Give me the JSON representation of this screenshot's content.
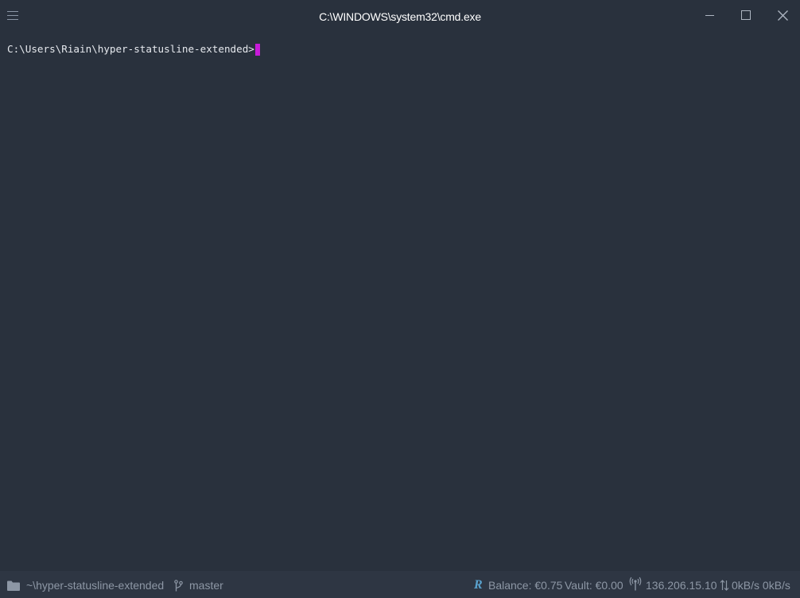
{
  "window": {
    "title": "C:\\WINDOWS\\system32\\cmd.exe",
    "menu_icon": "hamburger-menu-icon",
    "controls": [
      "minimize-icon",
      "maximize-icon",
      "close-icon"
    ]
  },
  "terminal": {
    "prompt": "C:\\Users\\Riain\\hyper-statusline-extended>",
    "cursor_color": "#c71ad9",
    "background": "#29313d"
  },
  "statusbar": {
    "cwd_icon": "folder-icon",
    "cwd": "~\\hyper-statusline-extended",
    "branch_icon": "git-branch-icon",
    "branch": "master",
    "balance_icon": "r-logo",
    "balance_logo": "R",
    "balance": "Balance: €0.75",
    "vault": "Vault: €0.00",
    "ip_icon": "antenna-icon",
    "ip": "136.206.15.10",
    "network_icon": "up-down-arrows-icon",
    "network": "0kB/s 0kB/s"
  }
}
